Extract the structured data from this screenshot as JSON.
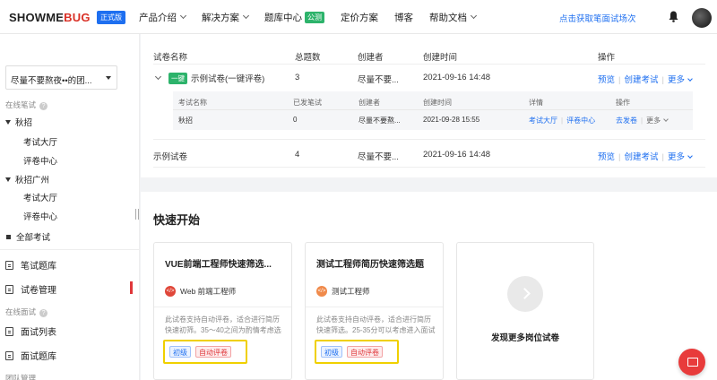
{
  "header": {
    "logo_main": "SHOWME",
    "logo_accent": "BUG",
    "edition_badge": "正式版",
    "nav": [
      {
        "label": "产品介绍",
        "dropdown": true
      },
      {
        "label": "解决方案",
        "dropdown": true
      },
      {
        "label": "题库中心",
        "badge": "公测"
      },
      {
        "label": "定价方案"
      },
      {
        "label": "博客"
      },
      {
        "label": "帮助文档",
        "dropdown": true
      }
    ],
    "cta_link": "点击获取笔面试场次",
    "icons": [
      "bell-icon",
      "avatar"
    ]
  },
  "sidebar": {
    "team_name": "尽量不要熬夜••的团...",
    "section_written": "在线笔试",
    "groups": [
      {
        "label": "秋招",
        "children": [
          "考试大厅",
          "评卷中心"
        ]
      },
      {
        "label": "秋招广州",
        "children": [
          "考试大厅",
          "评卷中心"
        ]
      }
    ],
    "all_exams": "全部考试",
    "menu": [
      {
        "label": "笔试题库"
      },
      {
        "label": "试卷管理",
        "active": true
      }
    ],
    "section_interview": "在线面试",
    "menu2": [
      {
        "label": "面试列表"
      },
      {
        "label": "面试题库"
      }
    ],
    "section_cut": "团队管理"
  },
  "table": {
    "headers": {
      "name": "试卷名称",
      "count": "总题数",
      "creator": "创建者",
      "created": "创建时间",
      "ops": "操作"
    },
    "rows": [
      {
        "tag": "一键",
        "name": "示例试卷(一键评卷)",
        "count": "3",
        "creator": "尽量不要...",
        "created": "2021-09-16 14:48",
        "op1": "预览",
        "op2": "创建考试",
        "op3": "更多"
      },
      {
        "name": "示例试卷",
        "count": "4",
        "creator": "尽量不要...",
        "created": "2021-09-16 14:48",
        "op1": "预览",
        "op2": "创建考试",
        "op3": "更多"
      }
    ],
    "sub": {
      "headers": {
        "name": "考试名称",
        "sent": "已发笔试",
        "creator": "创建者",
        "created": "创建时间",
        "detail": "详情",
        "ops": "操作"
      },
      "row": {
        "name": "秋招",
        "sent": "0",
        "creator": "尽量不要熬...",
        "created": "2021-09-28 15:55",
        "detail1": "考试大厅",
        "detail2": "评卷中心",
        "op1": "去发卷",
        "op2": "更多"
      }
    }
  },
  "quickstart": {
    "title": "快速开始",
    "templates": [
      {
        "name": "VUE前端工程师快速筛选...",
        "role": "Web 前端工程师",
        "role_color": "#e0473a",
        "desc": "此试卷支持自动评卷，适合进行简历快速初筛。35～40之间为酌情考虑选",
        "tag1": "初级",
        "tag2": "自动评卷"
      },
      {
        "name": "测试工程师简历快速筛选题",
        "role": "测试工程师",
        "role_color": "#f08a4b",
        "desc": "此试卷支持自动评卷，适合进行简历快速筛选。25-35分可以考虑进入面试",
        "tag1": "初级",
        "tag2": "自动评卷"
      }
    ],
    "discover": "发现更多岗位试卷"
  }
}
